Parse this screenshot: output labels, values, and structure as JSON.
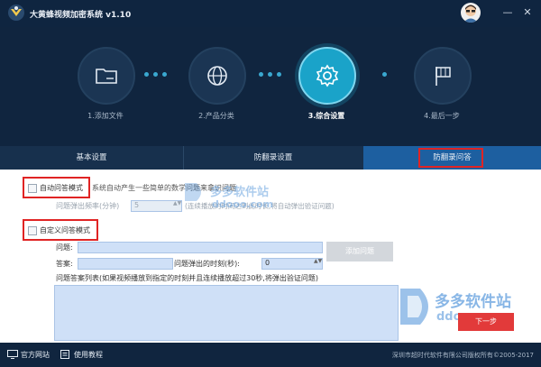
{
  "app": {
    "title": "大黄蜂视频加密系统 v1.10"
  },
  "window": {
    "minimize": "—",
    "close": "✕"
  },
  "steps": [
    {
      "label": "1.添加文件",
      "icon": "folder-icon",
      "active": false
    },
    {
      "label": "2.产品分类",
      "icon": "globe-icon",
      "active": false
    },
    {
      "label": "3.综合设置",
      "icon": "gear-icon",
      "active": true
    },
    {
      "label": "4.最后一步",
      "icon": "flag-icon",
      "active": false
    }
  ],
  "tabs": [
    {
      "label": "基本设置",
      "active": false
    },
    {
      "label": "防翻录设置",
      "active": false
    },
    {
      "label": "防翻录问答",
      "active": true
    }
  ],
  "auto_qa": {
    "checkbox_label": "自动问答模式",
    "description": "系统自动产生一些简单的数学问题来拿识问题",
    "frequency_label": "问题弹出频率(分钟)",
    "frequency_value": "5",
    "frequency_hint": "(连续播放的时间达到此时长,将自动弹出验证问题)"
  },
  "custom_qa": {
    "checkbox_label": "自定义问答模式",
    "question_label": "问题:",
    "answer_label": "答案:",
    "popup_time_label": "问题弹出的时刻(秒):",
    "popup_time_value": "0",
    "add_button": "添加问题",
    "list_label": "问题答案列表(如果视频播放到指定的时刻并且连续播放超过30秒,将弹出验证问题)"
  },
  "next_button": "下一步",
  "watermark": {
    "text_cn": "多多软件站",
    "text_en": "ddooo.com"
  },
  "footer": {
    "official_site": "官方网站",
    "tutorial": "使用教程",
    "copyright": "深圳市超时代软件有限公司版权所有©2005-2017"
  },
  "colors": {
    "accent": "#1aa3c9",
    "highlight": "#e02424",
    "bg": "#10253f"
  }
}
